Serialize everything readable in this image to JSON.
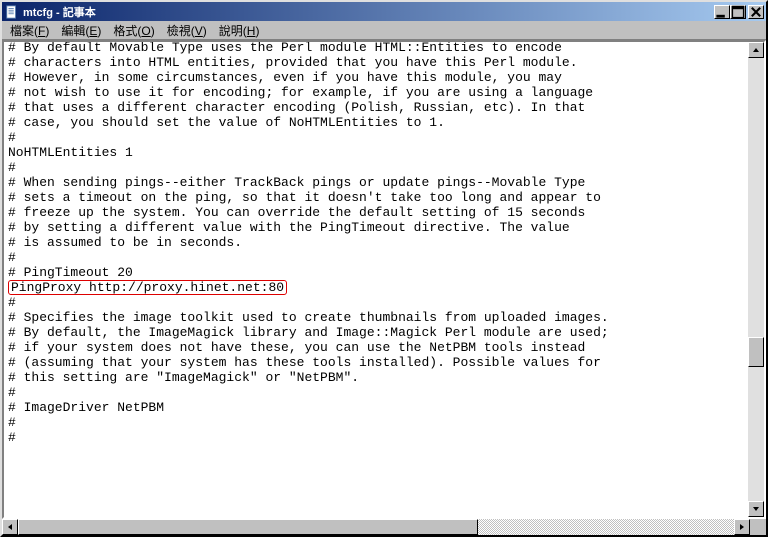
{
  "window": {
    "title": "mtcfg - 記事本"
  },
  "menu": {
    "items": [
      {
        "label": "檔案",
        "accel": "F"
      },
      {
        "label": "編輯",
        "accel": "E"
      },
      {
        "label": "格式",
        "accel": "O"
      },
      {
        "label": "檢視",
        "accel": "V"
      },
      {
        "label": "說明",
        "accel": "H"
      }
    ]
  },
  "editor": {
    "lines": [
      "# By default Movable Type uses the Perl module HTML::Entities to encode",
      "# characters into HTML entities, provided that you have this Perl module.",
      "# However, in some circumstances, even if you have this module, you may",
      "# not wish to use it for encoding; for example, if you are using a language",
      "# that uses a different character encoding (Polish, Russian, etc). In that",
      "# case, you should set the value of NoHTMLEntities to 1.",
      "#",
      "NoHTMLEntities 1",
      "#",
      "# When sending pings--either TrackBack pings or update pings--Movable Type",
      "# sets a timeout on the ping, so that it doesn't take too long and appear to",
      "# freeze up the system. You can override the default setting of 15 seconds",
      "# by setting a different value with the PingTimeout directive. The value",
      "# is assumed to be in seconds.",
      "#",
      "# PingTimeout 20",
      "PingProxy http://proxy.hinet.net:80",
      "#",
      "# Specifies the image toolkit used to create thumbnails from uploaded images.",
      "# By default, the ImageMagick library and Image::Magick Perl module are used;",
      "# if your system does not have these, you can use the NetPBM tools instead",
      "# (assuming that your system has these tools installed). Possible values for",
      "# this setting are \"ImageMagick\" or \"NetPBM\".",
      "#",
      "# ImageDriver NetPBM",
      "#",
      "#"
    ],
    "highlighted_line_index": 16
  },
  "scroll": {
    "vthumb_top_pct": 63
  }
}
